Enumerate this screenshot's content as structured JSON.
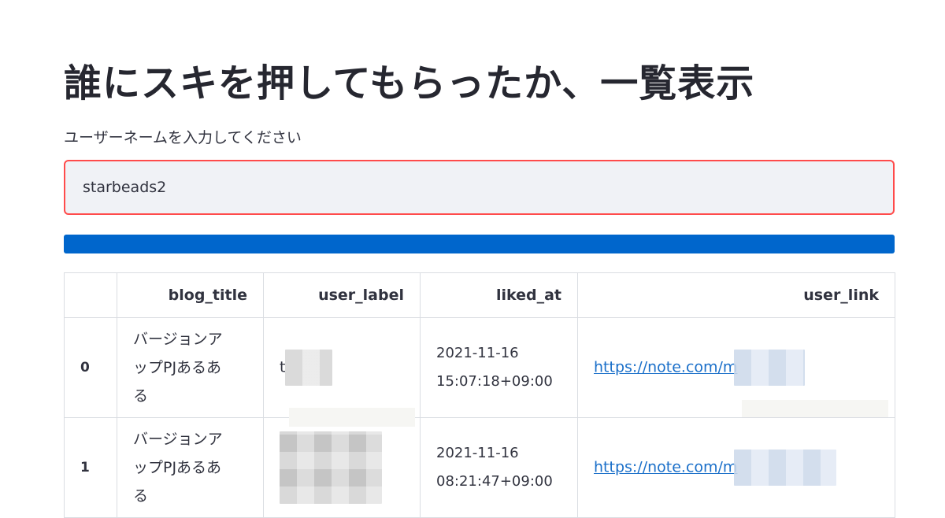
{
  "page": {
    "title": "誰にスキを押してもらったか、一覧表示",
    "input_label": "ユーザーネームを入力してください",
    "username_value": "starbeads2"
  },
  "progress": {
    "percent": 100,
    "color": "#0066cc"
  },
  "table": {
    "columns": [
      "",
      "blog_title",
      "user_label",
      "liked_at",
      "user_link"
    ],
    "rows": [
      {
        "index": "0",
        "blog_title_lines": [
          "バージョンア",
          "ップPJあるあ",
          "る"
        ],
        "user_label_visible": "t",
        "liked_at_date": "2021-11-16",
        "liked_at_time": "15:07:18+09:00",
        "user_link_visible": "https://note.com/m"
      },
      {
        "index": "1",
        "blog_title_lines": [
          "バージョンア",
          "ップPJあるあ",
          "る"
        ],
        "user_label_visible": "",
        "liked_at_date": "2021-11-16",
        "liked_at_time": "08:21:47+09:00",
        "user_link_visible": "https://note.com/m"
      }
    ]
  },
  "colors": {
    "input_border_focus": "#ff4b4b",
    "input_background": "#f0f2f6",
    "link": "#1a6fc9"
  }
}
